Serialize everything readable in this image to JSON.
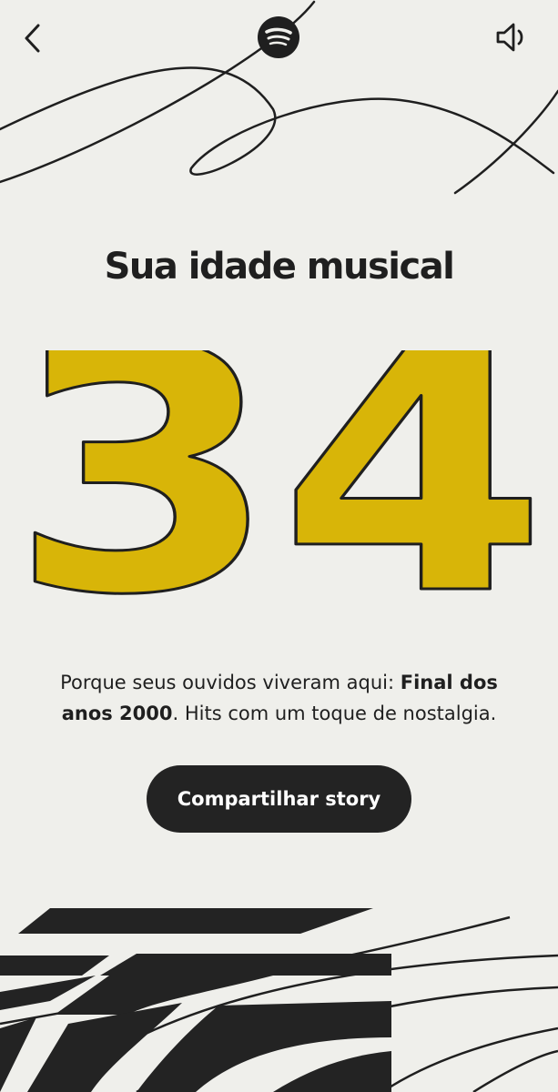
{
  "colors": {
    "background": "#efefeb",
    "accent_yellow": "#d8b508",
    "ink": "#232323"
  },
  "header": {
    "back_icon": "chevron-left-icon",
    "logo_icon": "spotify-logo-icon",
    "sound_icon": "speaker-icon"
  },
  "main": {
    "title": "Sua idade musical",
    "age": "34",
    "description": {
      "prefix": "Porque seus ouvidos viveram aqui: ",
      "highlight": "Final dos anos 2000",
      "suffix": ". Hits com um toque de nostalgia."
    },
    "share_label": "Compartilhar story"
  }
}
